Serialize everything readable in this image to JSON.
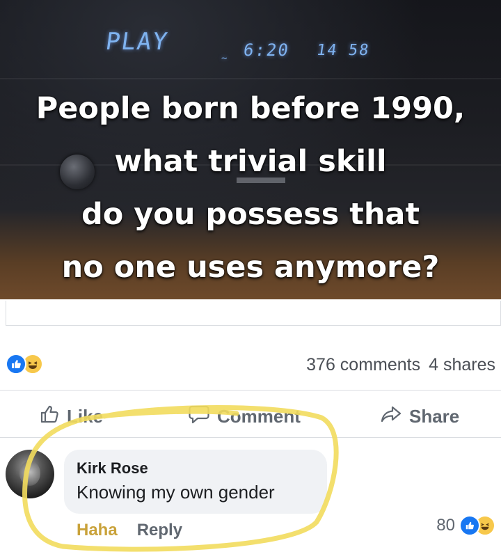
{
  "meme": {
    "display_play": "PLAY",
    "display_time": "6:20",
    "display_counter": "14 58",
    "caption_lines": [
      "People born before 1990,",
      "what trivial skill",
      "do you possess that",
      "no one uses anymore?"
    ]
  },
  "post_stats": {
    "comments": "376 comments",
    "shares": "4 shares",
    "reaction_icons": [
      "like-icon",
      "haha-icon"
    ]
  },
  "actions": {
    "like": "Like",
    "comment": "Comment",
    "share": "Share"
  },
  "comment": {
    "author": "Kirk Rose",
    "text": "Knowing my own gender",
    "haha_label": "Haha",
    "reply_label": "Reply",
    "reaction_count": "80"
  },
  "colors": {
    "like_blue": "#1877f2",
    "haha_yellow": "#f7c84b",
    "highlight_circle": "#f2dc5d",
    "meta_gray": "#606770"
  }
}
